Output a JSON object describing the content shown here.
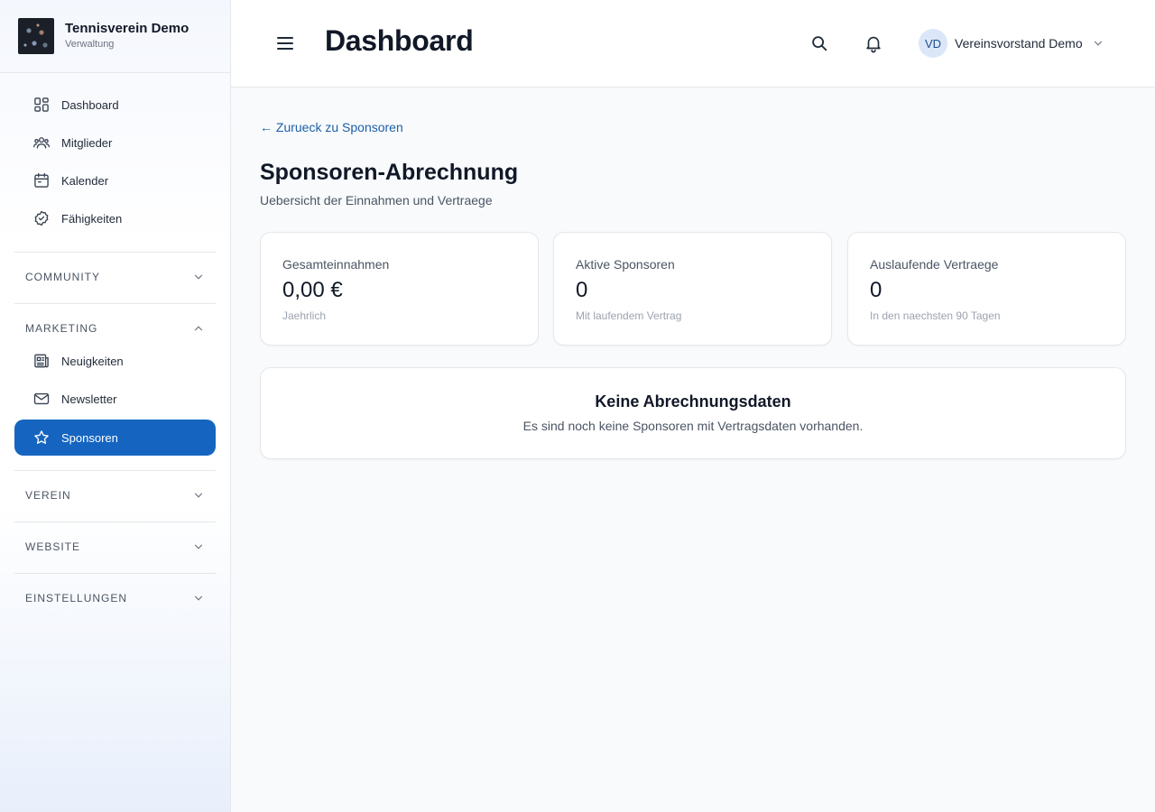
{
  "brand": {
    "name": "Tennisverein Demo",
    "subtitle": "Verwaltung"
  },
  "sidebar": {
    "items": [
      {
        "label": "Dashboard",
        "icon": "dashboard-icon"
      },
      {
        "label": "Mitglieder",
        "icon": "users-icon"
      },
      {
        "label": "Kalender",
        "icon": "calendar-icon"
      },
      {
        "label": "Fähigkeiten",
        "icon": "badge-check-icon"
      }
    ],
    "sections": {
      "community": {
        "label": "COMMUNITY",
        "expanded": false
      },
      "marketing": {
        "label": "MARKETING",
        "expanded": true,
        "items": [
          {
            "label": "Neuigkeiten",
            "icon": "newspaper-icon"
          },
          {
            "label": "Newsletter",
            "icon": "mail-icon"
          },
          {
            "label": "Sponsoren",
            "icon": "star-icon",
            "active": true
          }
        ]
      },
      "verein": {
        "label": "VEREIN",
        "expanded": false
      },
      "website": {
        "label": "WEBSITE",
        "expanded": false
      },
      "einstellungen": {
        "label": "EINSTELLUNGEN",
        "expanded": false
      }
    }
  },
  "header": {
    "title": "Dashboard",
    "user": {
      "initials": "VD",
      "name": "Vereinsvorstand Demo"
    }
  },
  "main": {
    "back_link": "← Zurueck zu Sponsoren",
    "title": "Sponsoren-Abrechnung",
    "subtitle": "Uebersicht der Einnahmen und Vertraege",
    "cards": [
      {
        "label": "Gesamteinnahmen",
        "value": "0,00 €",
        "note": "Jaehrlich"
      },
      {
        "label": "Aktive Sponsoren",
        "value": "0",
        "note": "Mit laufendem Vertrag"
      },
      {
        "label": "Auslaufende Vertraege",
        "value": "0",
        "note": "In den naechsten 90 Tagen"
      }
    ],
    "empty_state": {
      "title": "Keine Abrechnungsdaten",
      "text": "Es sind noch keine Sponsoren mit Vertragsdaten vorhanden."
    }
  },
  "colors": {
    "accent": "#1565c0",
    "link": "#1d5fa8",
    "background": "#f8fafc"
  }
}
